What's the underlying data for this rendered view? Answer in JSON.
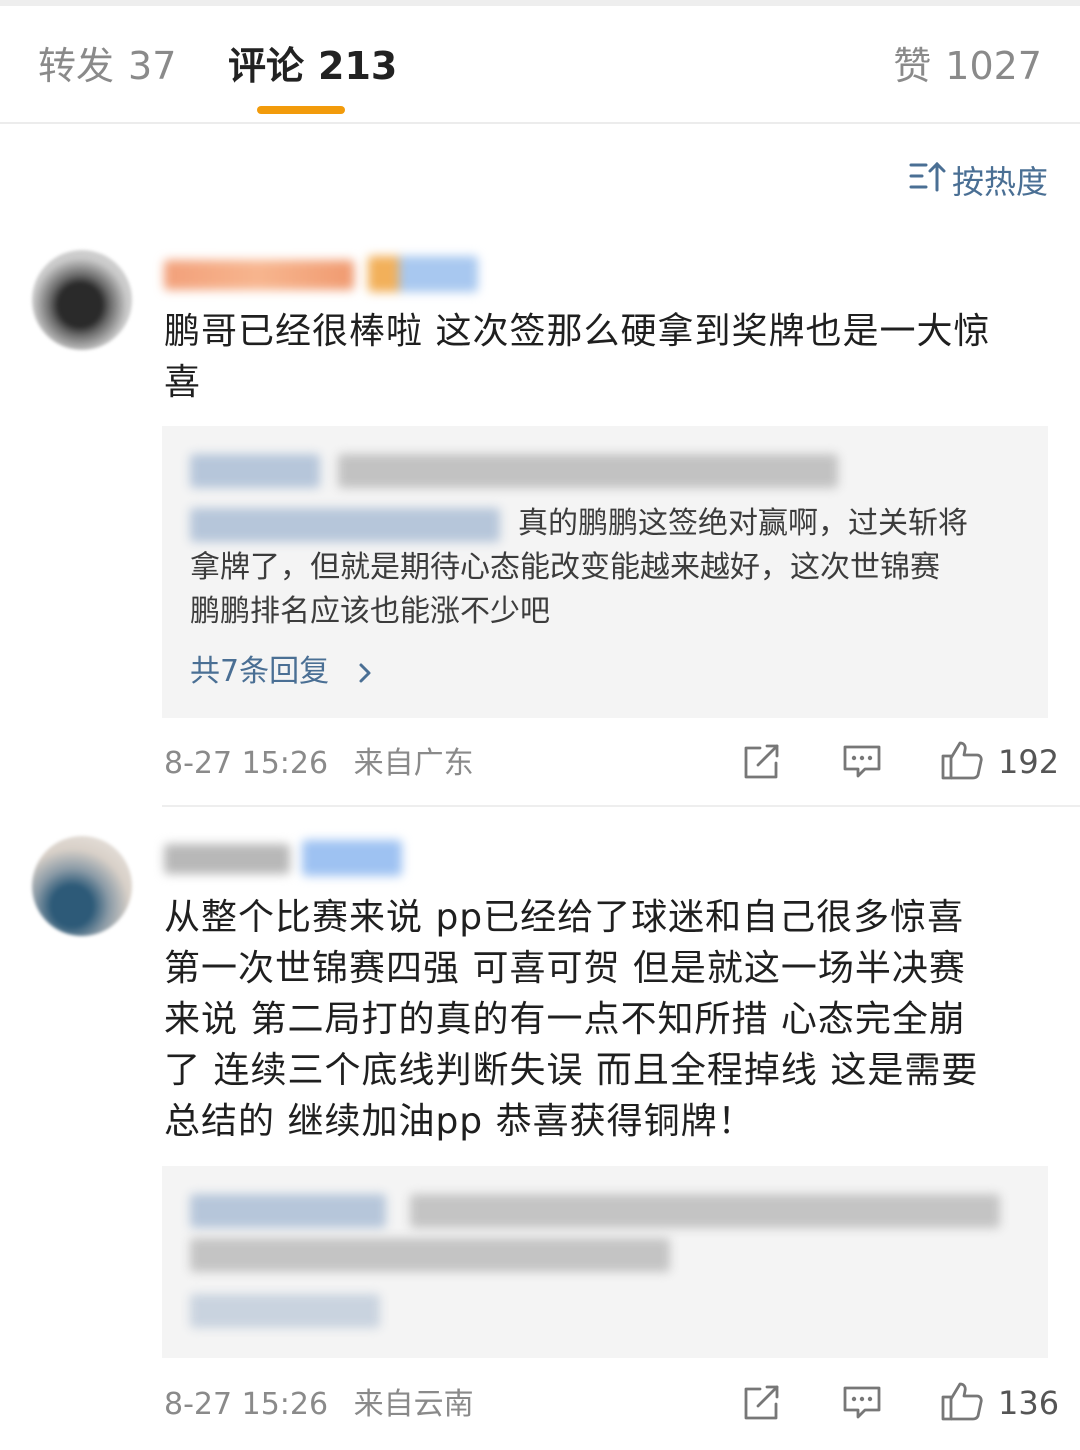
{
  "tabs": {
    "repost_label": "转发",
    "repost_count": "37",
    "comment_label": "评论",
    "comment_count": "213",
    "like_label": "赞",
    "like_count": "1027"
  },
  "sort_label": "按热度",
  "comments": [
    {
      "text_lines": [
        "鹏哥已经很棒啦 这次签那么硬拿到奖牌也是一大惊",
        "喜"
      ],
      "reply_lines": [
        "真的鹏鹏这签绝对赢啊，过关斩将",
        "拿牌了，但就是期待心态能改变能越来越好，这次世锦赛",
        "鹏鹏排名应该也能涨不少吧"
      ],
      "more_replies": "共7条回复",
      "time": "8-27 15:26",
      "location": "来自广东",
      "likes": "192"
    },
    {
      "text_lines": [
        "从整个比赛来说 pp已经给了球迷和自己很多惊喜",
        "第一次世锦赛四强 可喜可贺 但是就这一场半决赛",
        "来说 第二局打的真的有一点不知所措 心态完全崩",
        "了 连续三个底线判断失误 而且全程掉线 这是需要",
        "总结的 继续加油pp 恭喜获得铜牌！"
      ],
      "time": "8-27 15:26",
      "location": "来自云南",
      "likes": "136"
    }
  ],
  "colors": {
    "accent": "#f29b0b",
    "link": "#4a6f94"
  }
}
